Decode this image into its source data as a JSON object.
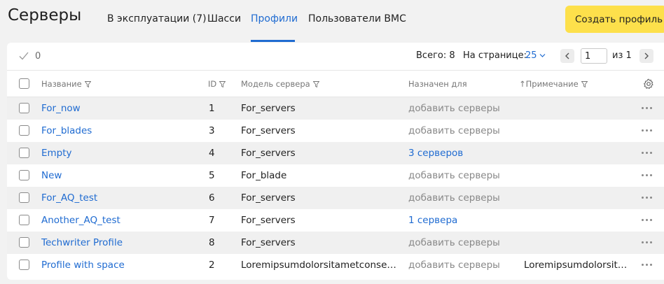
{
  "header": {
    "title": "Серверы",
    "tabs": [
      {
        "label": "В эксплуатации (7)"
      },
      {
        "label": "Шасси"
      },
      {
        "label": "Профили"
      },
      {
        "label": "Пользователи BMC"
      }
    ],
    "active_tab": "Профили",
    "create_button": "Создать профиль"
  },
  "toolbar": {
    "selected_count": "0",
    "total": "Всего: 8",
    "per_page_label": "На странице:",
    "per_page_value": "25",
    "page_input": "1",
    "page_of": "из  1"
  },
  "table": {
    "columns": {
      "name": "Название",
      "id": "ID",
      "model": "Модель сервера",
      "assigned": "Назначен для",
      "note": "↑Примечание"
    },
    "rows": [
      {
        "name": "For_now",
        "id": "1",
        "model": "For_servers",
        "assigned": "добавить серверы",
        "assigned_link": false,
        "note": ""
      },
      {
        "name": "For_blades",
        "id": "3",
        "model": "For_servers",
        "assigned": "добавить серверы",
        "assigned_link": false,
        "note": ""
      },
      {
        "name": "Empty",
        "id": "4",
        "model": "For_servers",
        "assigned": "3 серверов",
        "assigned_link": true,
        "note": ""
      },
      {
        "name": "New",
        "id": "5",
        "model": "For_blade",
        "assigned": "добавить серверы",
        "assigned_link": false,
        "note": ""
      },
      {
        "name": "For_AQ_test",
        "id": "6",
        "model": "For_servers",
        "assigned": "добавить серверы",
        "assigned_link": false,
        "note": ""
      },
      {
        "name": "Another_AQ_test",
        "id": "7",
        "model": "For_servers",
        "assigned": "1 сервера",
        "assigned_link": true,
        "note": ""
      },
      {
        "name": "Techwriter Profile",
        "id": "8",
        "model": "For_servers",
        "assigned": "добавить серверы",
        "assigned_link": false,
        "note": ""
      },
      {
        "name": "Profile with space",
        "id": "2",
        "model": "Loremipsumdolorsitametconsectetur",
        "assigned": "добавить серверы",
        "assigned_link": false,
        "note": "Loremipsumdolorsitamet"
      }
    ]
  },
  "colors": {
    "accent": "#1f6bd1",
    "primary_button": "#fde04b",
    "row_stripe": "#f0f0f0",
    "page_bg": "#f2f2f2"
  },
  "icons": [
    "check-icon",
    "filter-icon",
    "chevron-down-icon",
    "chevron-left-icon",
    "chevron-right-icon",
    "gear-icon",
    "more-icon"
  ]
}
